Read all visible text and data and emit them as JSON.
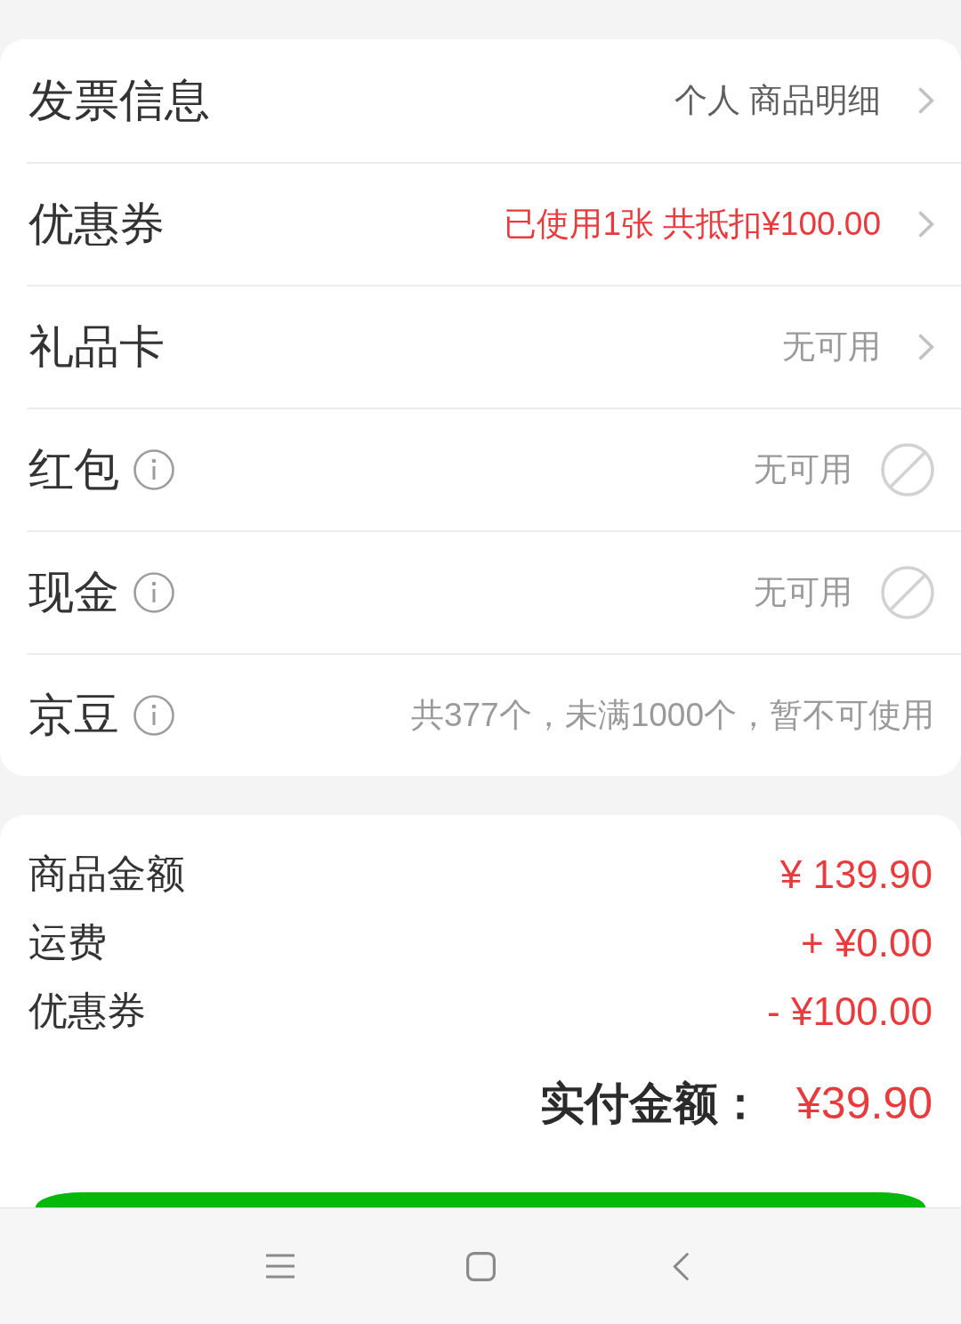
{
  "options": [
    {
      "kind": "link",
      "label": "发票信息",
      "info": false,
      "value": "个人 商品明细",
      "color": "#5f5f5f"
    },
    {
      "kind": "link",
      "label": "优惠券",
      "info": false,
      "value": "已使用1张 共抵扣¥100.00",
      "color": "#e93b3d"
    },
    {
      "kind": "link",
      "label": "礼品卡",
      "info": false,
      "value": "无可用",
      "color": "#9a9a9a"
    },
    {
      "kind": "check",
      "label": "红包",
      "info": true,
      "value": "无可用",
      "color": "#9a9a9a",
      "disabled": true
    },
    {
      "kind": "check",
      "label": "现金",
      "info": true,
      "value": "无可用",
      "color": "#9a9a9a",
      "disabled": true
    },
    {
      "kind": "text",
      "label": "京豆",
      "info": true,
      "value": "共377个，未满1000个，暂不可使用",
      "color": "#9a9a9a"
    }
  ],
  "summary": [
    {
      "label": "商品金额",
      "amount": "¥ 139.90"
    },
    {
      "label": "运费",
      "amount": "+ ¥0.00"
    },
    {
      "label": "优惠券",
      "amount": "- ¥100.00"
    }
  ],
  "total": {
    "label": "实付金额：",
    "amount": "¥39.90"
  },
  "nav_bar": [
    {
      "kind": "menu"
    },
    {
      "kind": "home"
    },
    {
      "kind": "back"
    }
  ]
}
